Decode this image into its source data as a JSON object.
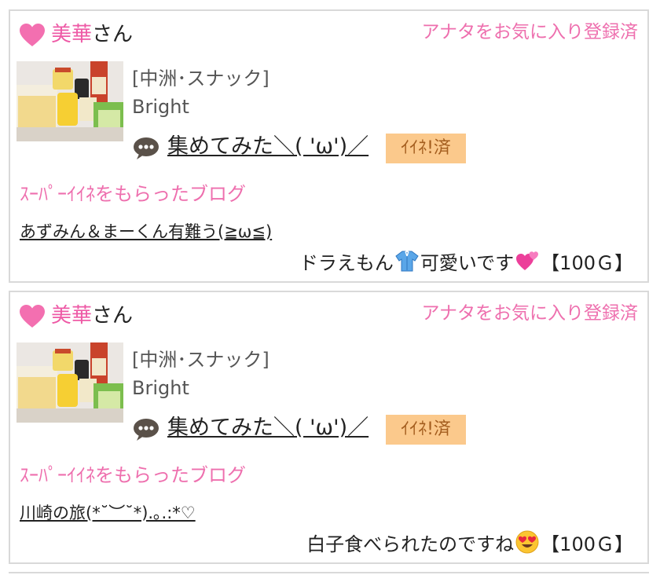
{
  "posts": [
    {
      "user_name": "美華",
      "user_suffix": "さん",
      "fav_status": "アナタをお気に入り登録済",
      "shop": "[中洲･スナック]",
      "store": "Bright",
      "title": "集めてみた＼( 'ω')／",
      "like_badge": "ｲｲﾈ!済",
      "super_like_label": "ｽｰﾊﾟｰｲｲﾈをもらったブログ",
      "blog_title": "あずみん＆まーくん有難う(≧ω≦)",
      "message_before": "ドラえもん",
      "message_mid": "可愛いです",
      "message_emoji_1": "shirt-emoji",
      "message_emoji_2": "two-hearts-emoji",
      "reward": "【100Ｇ】"
    },
    {
      "user_name": "美華",
      "user_suffix": "さん",
      "fav_status": "アナタをお気に入り登録済",
      "shop": "[中洲･スナック]",
      "store": "Bright",
      "title": "集めてみた＼( 'ω')／",
      "like_badge": "ｲｲﾈ!済",
      "super_like_label": "ｽｰﾊﾟｰｲｲﾈをもらったブログ",
      "blog_title": "川崎の旅(*˘︶˘*).｡.:*♡",
      "message_before": "白子食べられたのですね",
      "message_emoji_1": "heart-eyes-emoji",
      "reward": "【100Ｇ】"
    }
  ],
  "colors": {
    "accent_pink": "#ee5aa6",
    "badge_bg": "#fbc98c",
    "border": "#d9d9d9"
  }
}
